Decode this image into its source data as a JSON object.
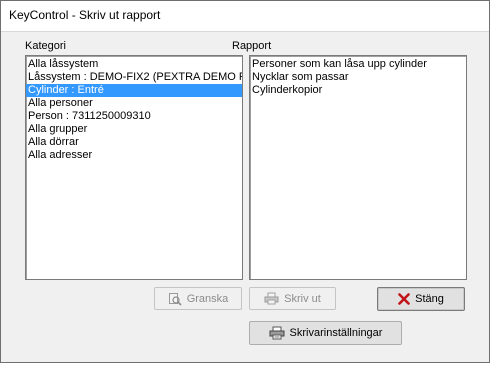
{
  "window": {
    "title": "KeyControl - Skriv ut rapport"
  },
  "kategori": {
    "label": "Kategori",
    "items": [
      "Alla låssystem",
      "Låssystem : DEMO-FIX2 (PEXTRA DEMO RI",
      "Cylinder : Entré",
      "Alla personer",
      "Person : 7311250009310",
      "Alla grupper",
      "Alla dörrar",
      "Alla adresser"
    ],
    "selected_index": 2
  },
  "rapport": {
    "label": "Rapport",
    "items": [
      "Personer som kan låsa upp cylinder",
      "Nycklar som passar",
      "Cylinderkopior"
    ]
  },
  "buttons": {
    "granska": "Granska",
    "skriv_ut": "Skriv ut",
    "stang": "Stäng",
    "skrivarinstallningar": "Skrivarinställningar"
  },
  "icons": {
    "granska": "preview-icon",
    "skriv_ut": "printer-icon",
    "stang": "close-icon",
    "skrivarinstallningar": "printer-settings-icon"
  },
  "colors": {
    "selection": "#3399ff",
    "close_x": "#c0141a"
  }
}
